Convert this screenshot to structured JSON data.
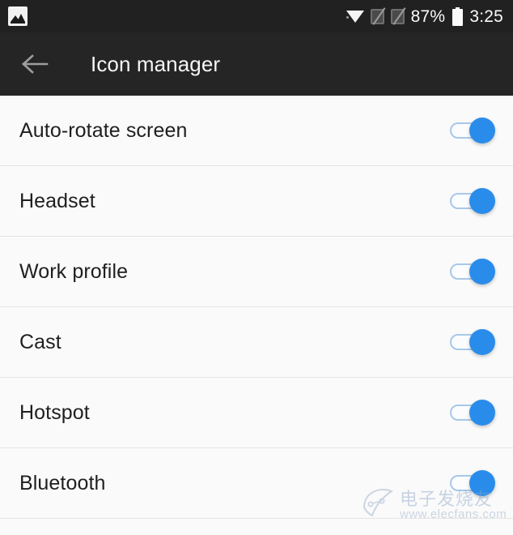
{
  "status_bar": {
    "notification_icon": "photo-icon",
    "wifi_icon": "wifi-icon",
    "sim1_icon": "sim-no-signal-icon",
    "sim2_icon": "sim-no-signal-icon",
    "battery_percent": "87%",
    "battery_icon": "battery-icon",
    "time": "3:25",
    "background_color": "#212121"
  },
  "app_bar": {
    "back_icon": "arrow-back-icon",
    "title": "Icon manager",
    "background_color": "#252525",
    "title_color": "#f5f5f5"
  },
  "list": {
    "accent_color": "#2a8cea",
    "track_color": "#a8c8ea",
    "rows": [
      {
        "label": "Auto-rotate screen",
        "state": "on"
      },
      {
        "label": "Headset",
        "state": "on"
      },
      {
        "label": "Work profile",
        "state": "on"
      },
      {
        "label": "Cast",
        "state": "on"
      },
      {
        "label": "Hotspot",
        "state": "on"
      },
      {
        "label": "Bluetooth",
        "state": "on"
      }
    ]
  },
  "watermark": {
    "text": "电子发烧友",
    "url": "www.elecfans.com"
  }
}
